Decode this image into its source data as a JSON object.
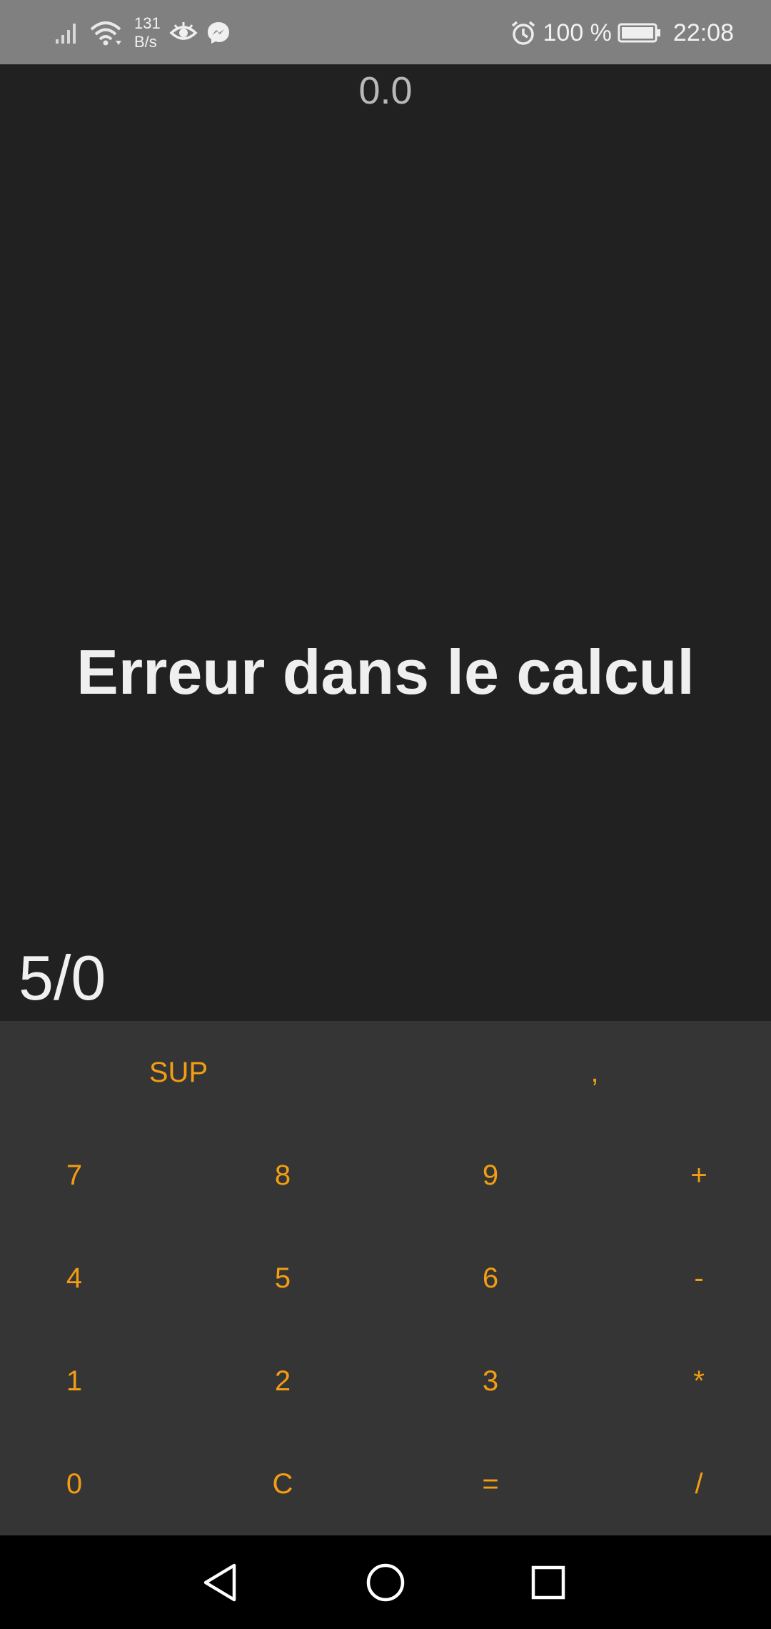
{
  "status_bar": {
    "net_speed_value": "131",
    "net_speed_unit": "B/s",
    "battery_percent": "100 %",
    "time": "22:08",
    "icons": [
      "signal-icon",
      "wifi-icon",
      "eye-icon",
      "messenger-icon",
      "alarm-icon",
      "battery-icon"
    ]
  },
  "display": {
    "history_result": "0.0",
    "message": "Erreur dans le calcul",
    "expression": "5/0"
  },
  "keypad": {
    "sup": "SUP",
    "comma": ",",
    "rows": [
      [
        "7",
        "8",
        "9",
        "+"
      ],
      [
        "4",
        "5",
        "6",
        "-"
      ],
      [
        "1",
        "2",
        "3",
        "*"
      ],
      [
        "0",
        "C",
        "=",
        "/"
      ]
    ]
  },
  "navigation": {
    "icons": [
      "back-icon",
      "home-icon",
      "recent-apps-icon"
    ]
  },
  "colors": {
    "background": "#212121",
    "keypad_background": "#353535",
    "key_text": "#f29d12",
    "status_bar": "#808080"
  }
}
